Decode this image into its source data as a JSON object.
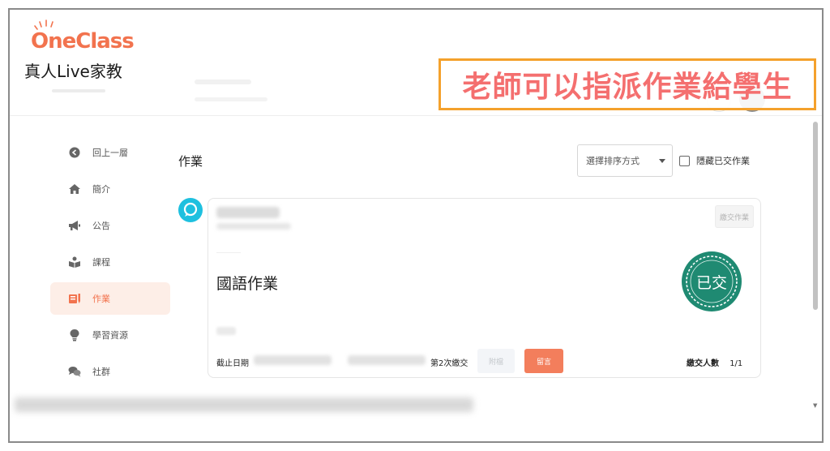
{
  "brand": {
    "logo_text": "OneClass",
    "tagline": "真人Live家教",
    "color": "#f2734e"
  },
  "annotation": {
    "text": "老師可以指派作業給學生",
    "border_color": "#f4a12c",
    "text_color": "#f46f6f"
  },
  "sidebar": {
    "items": [
      {
        "label": "回上一層",
        "icon": "back-arrow-circle-icon"
      },
      {
        "label": "簡介",
        "icon": "home-icon"
      },
      {
        "label": "公告",
        "icon": "megaphone-icon"
      },
      {
        "label": "課程",
        "icon": "book-reader-icon"
      },
      {
        "label": "作業",
        "icon": "homework-icon",
        "active": true
      },
      {
        "label": "學習資源",
        "icon": "lightbulb-icon"
      },
      {
        "label": "社群",
        "icon": "chat-bubbles-icon"
      }
    ]
  },
  "main": {
    "title": "作業",
    "sort_select": {
      "selected": "選擇排序方式"
    },
    "hide_submitted": {
      "label": "隱藏已交作業",
      "checked": false
    }
  },
  "assignment": {
    "submit_label": "繳交作業",
    "title": "國語作業",
    "stamp_text": "已交",
    "stamp_color": "#1f8a72",
    "deadline_label": "截止日期",
    "submit_count_label": "第2次繳交",
    "attach_label": "附檔",
    "comment_label": "留言",
    "comment_color": "#f37e5c",
    "submitted_label": "繳交人數",
    "submitted_value": "1/1"
  }
}
